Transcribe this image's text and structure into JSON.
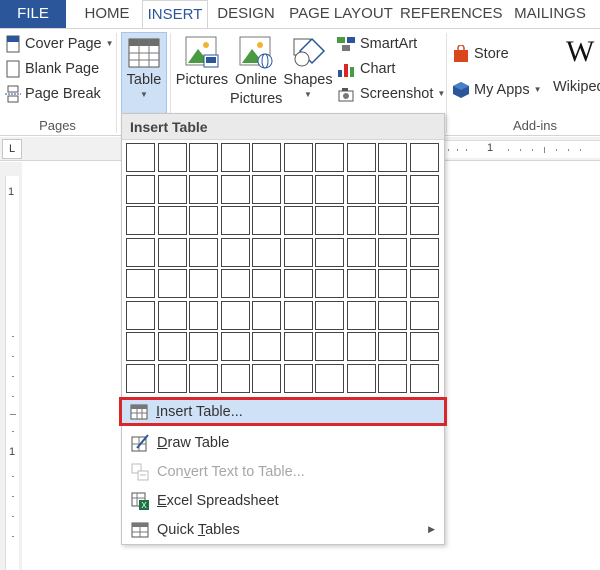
{
  "tabs": [
    {
      "label": "FILE"
    },
    {
      "label": "HOME"
    },
    {
      "label": "INSERT"
    },
    {
      "label": "DESIGN"
    },
    {
      "label": "PAGE LAYOUT"
    },
    {
      "label": "REFERENCES"
    },
    {
      "label": "MAILINGS"
    }
  ],
  "pages_group": {
    "label": "Pages",
    "cover_page": "Cover Page",
    "blank_page": "Blank Page",
    "page_break": "Page Break"
  },
  "tables_group": {
    "table_label": "Table"
  },
  "illustrations_group": {
    "pictures": "Pictures",
    "online_pictures_1": "Online",
    "online_pictures_2": "Pictures",
    "shapes": "Shapes",
    "smartart": "SmartArt",
    "chart": "Chart",
    "screenshot": "Screenshot"
  },
  "addins_group": {
    "label": "Add-ins",
    "store": "Store",
    "my_apps": "My Apps",
    "wikipedia": "Wikiped"
  },
  "ruler": {
    "h_mark": "1",
    "v_mark_top": "1",
    "v_mark_mid": "1",
    "corner": "L"
  },
  "dropdown": {
    "header": "Insert Table",
    "grid_rows": 8,
    "grid_cols": 10,
    "items": [
      {
        "pre": "",
        "ul": "I",
        "post": "nsert Table...",
        "icon": "insert-table-icon",
        "disabled": false
      },
      {
        "pre": "",
        "ul": "D",
        "post": "raw Table",
        "icon": "draw-table-icon",
        "disabled": false
      },
      {
        "pre": "Con",
        "ul": "v",
        "post": "ert Text to Table...",
        "icon": "convert-text-icon",
        "disabled": true
      },
      {
        "pre": "",
        "ul": "E",
        "post": "xcel Spreadsheet",
        "icon": "excel-icon",
        "disabled": false
      },
      {
        "pre": "Quick ",
        "ul": "T",
        "post": "ables",
        "icon": "quick-tables-icon",
        "disabled": false
      }
    ]
  },
  "colors": {
    "file_tab": "#2b579a",
    "highlight": "#cfe1f6",
    "highlight_border": "#d9262b"
  }
}
